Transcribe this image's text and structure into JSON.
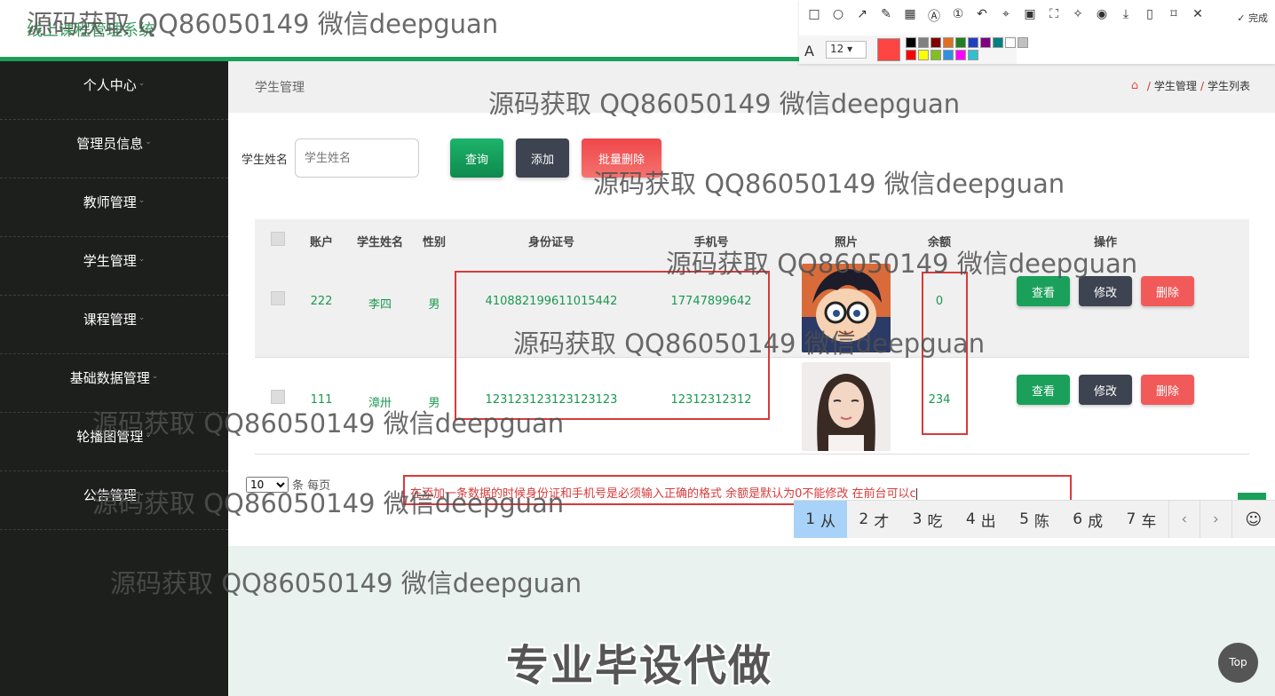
{
  "app": {
    "title": "线上课程管理系统"
  },
  "sidebar": {
    "items": [
      {
        "label": "个人中心"
      },
      {
        "label": "管理员信息"
      },
      {
        "label": "教师管理"
      },
      {
        "label": "学生管理"
      },
      {
        "label": "课程管理"
      },
      {
        "label": "基础数据管理"
      },
      {
        "label": "轮播图管理"
      },
      {
        "label": "公告管理"
      }
    ]
  },
  "header": {
    "page_title": "学生管理",
    "breadcrumb": [
      "学生管理",
      "学生列表"
    ],
    "breadcrumb_sep": "/"
  },
  "search": {
    "label": "学生姓名",
    "placeholder": "学生姓名",
    "query_label": "查询",
    "add_label": "添加",
    "batch_delete_label": "批量删除"
  },
  "table": {
    "columns": [
      "账户",
      "学生姓名",
      "性别",
      "身份证号",
      "手机号",
      "照片",
      "余额",
      "操作"
    ],
    "rows": [
      {
        "account": "222",
        "name": "李四",
        "gender": "男",
        "id_card": "410882199611015442",
        "phone": "17747899642",
        "balance": "0"
      },
      {
        "account": "111",
        "name": "漳卅",
        "gender": "男",
        "id_card": "123123123123123123",
        "phone": "12312312312",
        "balance": "234"
      }
    ],
    "actions": {
      "view": "查看",
      "edit": "修改",
      "delete": "删除"
    }
  },
  "pagination": {
    "page_size": "10",
    "page_size_suffix": "条 每页"
  },
  "annotation": {
    "note": "在添加一条数据的时候身份证和手机号是必须输入正确的格式 余额是默认为0不能修改 在前台可以c"
  },
  "ime": {
    "candidates": [
      {
        "num": "1",
        "text": "从"
      },
      {
        "num": "2",
        "text": "才"
      },
      {
        "num": "3",
        "text": "吃"
      },
      {
        "num": "4",
        "text": "出"
      },
      {
        "num": "5",
        "text": "陈"
      },
      {
        "num": "6",
        "text": "成"
      },
      {
        "num": "7",
        "text": "车"
      }
    ],
    "prev": "‹",
    "next": "›",
    "emoji": "☺"
  },
  "screenshot_toolbar": {
    "done_label": "完成",
    "font_size": "12",
    "current_color": "#ff4444",
    "palette": [
      "#000000",
      "#808080",
      "#800000",
      "#e07020",
      "#208020",
      "#2040c0",
      "#800080",
      "#008080",
      "#ffffff",
      "#c0c0c0",
      "#ff0000",
      "#ffff00",
      "#80c020",
      "#3090e0",
      "#ff00ff",
      "#30c0d0"
    ]
  },
  "slogan": "专业毕设代做",
  "top_button": "Top",
  "watermark": "源码获取 QQ86050149 微信deepguan",
  "colors": {
    "brand_green": "#1aa05a",
    "sidebar_bg": "#1d1f1d",
    "danger": "#f25a5a",
    "annotation_red": "#d83a3a"
  }
}
